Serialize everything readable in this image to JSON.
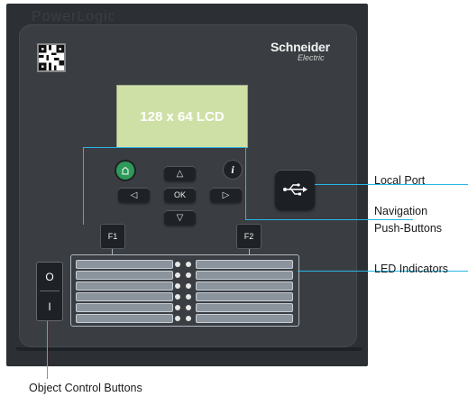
{
  "device": {
    "faint_brand": "PowerLogic",
    "brand_name": "Schneider",
    "brand_sub": "Electric",
    "lcd_text": "128 x 64 LCD"
  },
  "buttons": {
    "up": "△",
    "down": "▽",
    "left": "◁",
    "right": "▷",
    "ok": "OK",
    "home_icon": "home-icon",
    "info_icon": "info-icon",
    "f1": "F1",
    "f2": "F2",
    "obj_open": "O",
    "obj_close": "I",
    "usb_icon": "usb-icon"
  },
  "labels": {
    "local_port": "Local Port",
    "navigation_line1": "Navigation",
    "navigation_line2": "Push-Buttons",
    "led_indicators": "LED Indicators",
    "object_control": "Object Control Buttons"
  },
  "colors": {
    "callout_line": "#27b6e6",
    "lcd": "#cfe0a6",
    "home_button": "#2e9a59"
  }
}
